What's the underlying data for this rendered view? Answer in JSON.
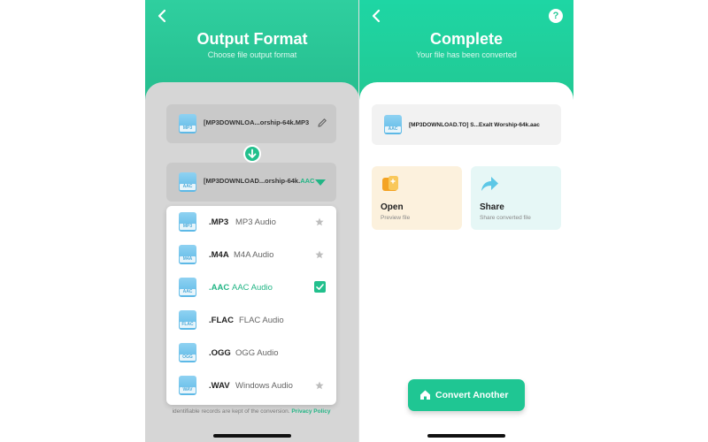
{
  "left_screen": {
    "title": "Output Format",
    "subtitle": "Choose file output format",
    "source_file": {
      "name": "[MP3DOWNLOA...orship-64k.MP3",
      "icon_label": "MP3"
    },
    "target_file": {
      "name_prefix": "[MP3DOWNLOAD...orship-64k.",
      "name_ext": "AAC",
      "icon_label": "AAC"
    },
    "formats": [
      {
        "icon_label": "MP3",
        "ext": ".MP3",
        "desc": "MP3 Audio",
        "starred": true,
        "selected": false
      },
      {
        "icon_label": "M4A",
        "ext": ".M4A",
        "desc": "M4A Audio",
        "starred": true,
        "selected": false
      },
      {
        "icon_label": "AAC",
        "ext": ".AAC",
        "desc": "AAC Audio",
        "starred": false,
        "selected": true
      },
      {
        "icon_label": "FLAC",
        "ext": ".FLAC",
        "desc": "FLAC Audio",
        "starred": false,
        "selected": false
      },
      {
        "icon_label": "OGG",
        "ext": ".OGG",
        "desc": "OGG Audio",
        "starred": false,
        "selected": false
      },
      {
        "icon_label": "WAV",
        "ext": ".WAV",
        "desc": "Windows Audio",
        "starred": true,
        "selected": false
      }
    ],
    "policy_text": "identifiable records are kept of the conversion.",
    "policy_link": "Privacy Policy"
  },
  "right_screen": {
    "title": "Complete",
    "subtitle": "Your file has been converted",
    "help_label": "?",
    "result_file": {
      "name": "[MP3DOWNLOAD.TO] S...Exalt Worship-64k.aac",
      "icon_label": "AAC"
    },
    "actions": [
      {
        "label": "Open",
        "sub": "Preview file"
      },
      {
        "label": "Share",
        "sub": "Share converted file"
      }
    ],
    "convert_button": "Convert Another"
  },
  "colors": {
    "accent": "#22c08d",
    "header_gradient_top": "#1ed6a4",
    "open_card_bg": "#fcf1dd",
    "share_card_bg": "#e6f7f6"
  },
  "icons": [
    "back-arrow-icon",
    "help-icon",
    "audio-file-icon",
    "pencil-icon",
    "arrow-down-icon",
    "dropdown-triangle-icon",
    "star-icon",
    "checkmark-icon",
    "open-folder-icon",
    "share-arrow-icon",
    "home-icon"
  ]
}
